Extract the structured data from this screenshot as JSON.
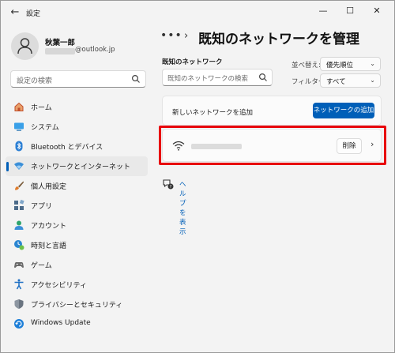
{
  "window": {
    "title": "設定",
    "controls": {
      "minimize": "—",
      "maximize": "☐",
      "close": "✕"
    },
    "back_icon": "back-arrow-icon"
  },
  "profile": {
    "name": "秋葉一郎",
    "email_suffix": "@outlook.jp"
  },
  "search": {
    "placeholder": "設定の検索"
  },
  "nav": {
    "items": [
      {
        "label": "ホーム",
        "icon": "home-icon",
        "color": "#c14e2b",
        "active": false
      },
      {
        "label": "システム",
        "icon": "system-icon",
        "color": "#1e90d6",
        "active": false
      },
      {
        "label": "Bluetooth とデバイス",
        "icon": "bluetooth-icon",
        "color": "#2b7fd4",
        "active": false
      },
      {
        "label": "ネットワークとインターネット",
        "icon": "network-icon",
        "color": "#3a8fd8",
        "active": true
      },
      {
        "label": "個人用設定",
        "icon": "brush-icon",
        "color": "#e07b2a",
        "active": false
      },
      {
        "label": "アプリ",
        "icon": "apps-icon",
        "color": "#4c6b8a",
        "active": false
      },
      {
        "label": "アカウント",
        "icon": "account-icon",
        "color": "#2fa56e",
        "active": false
      },
      {
        "label": "時刻と言語",
        "icon": "clock-language-icon",
        "color": "#2b86d1",
        "active": false
      },
      {
        "label": "ゲーム",
        "icon": "game-icon",
        "color": "#6b6b6b",
        "active": false
      },
      {
        "label": "アクセシビリティ",
        "icon": "accessibility-icon",
        "color": "#1d6fc4",
        "active": false
      },
      {
        "label": "プライバシーとセキュリティ",
        "icon": "shield-icon",
        "color": "#6a7480",
        "active": false
      },
      {
        "label": "Windows Update",
        "icon": "update-icon",
        "color": "#1e7fd8",
        "active": false
      }
    ]
  },
  "main": {
    "breadcrumb": {
      "dots": "•••",
      "separator": "›",
      "title": "既知のネットワークを管理"
    },
    "known_networks": {
      "label": "既知のネットワーク",
      "search_placeholder": "既知のネットワークの検索"
    },
    "sort": {
      "label": "並べ替え:",
      "value": "優先順位"
    },
    "filter": {
      "label": "フィルター:",
      "value": "すべて"
    },
    "add_network": {
      "label": "新しいネットワークを追加",
      "button": "ネットワークの追加"
    },
    "network_row": {
      "delete_button": "削除",
      "chevron": "›",
      "icon": "wifi-icon"
    },
    "help": {
      "label": "ヘルプを表示",
      "icon": "help-icon"
    }
  },
  "colors": {
    "accent": "#005fb8",
    "highlight": "#e8000b",
    "background": "#f3f3f3"
  }
}
